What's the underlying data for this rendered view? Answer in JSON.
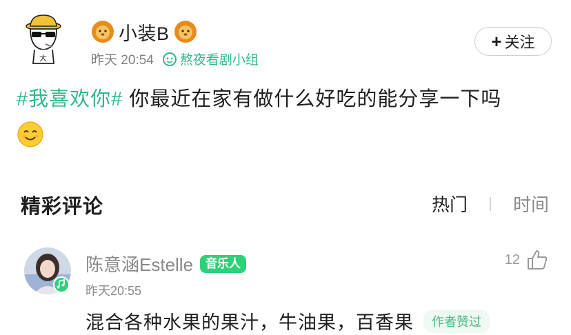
{
  "post": {
    "author": "小装B",
    "time": "昨天 20:54",
    "group": "熬夜看剧小组",
    "follow_label": "关注",
    "hashtag": "#我喜欢你#",
    "text": " 你最近在家有做什么好吃的能分享一下吗"
  },
  "comments_section": {
    "title": "精彩评论",
    "sort_hot": "热门",
    "sort_time": "时间"
  },
  "comment": {
    "author": "陈意涵Estelle",
    "badge": "音乐人",
    "time": "昨天20:55",
    "likes": "12",
    "text": "混合各种水果的果汁，牛油果，百香果",
    "author_liked": "作者赞过"
  },
  "colors": {
    "accent_green": "#2fb98a",
    "badge_green": "#2fd07a"
  }
}
